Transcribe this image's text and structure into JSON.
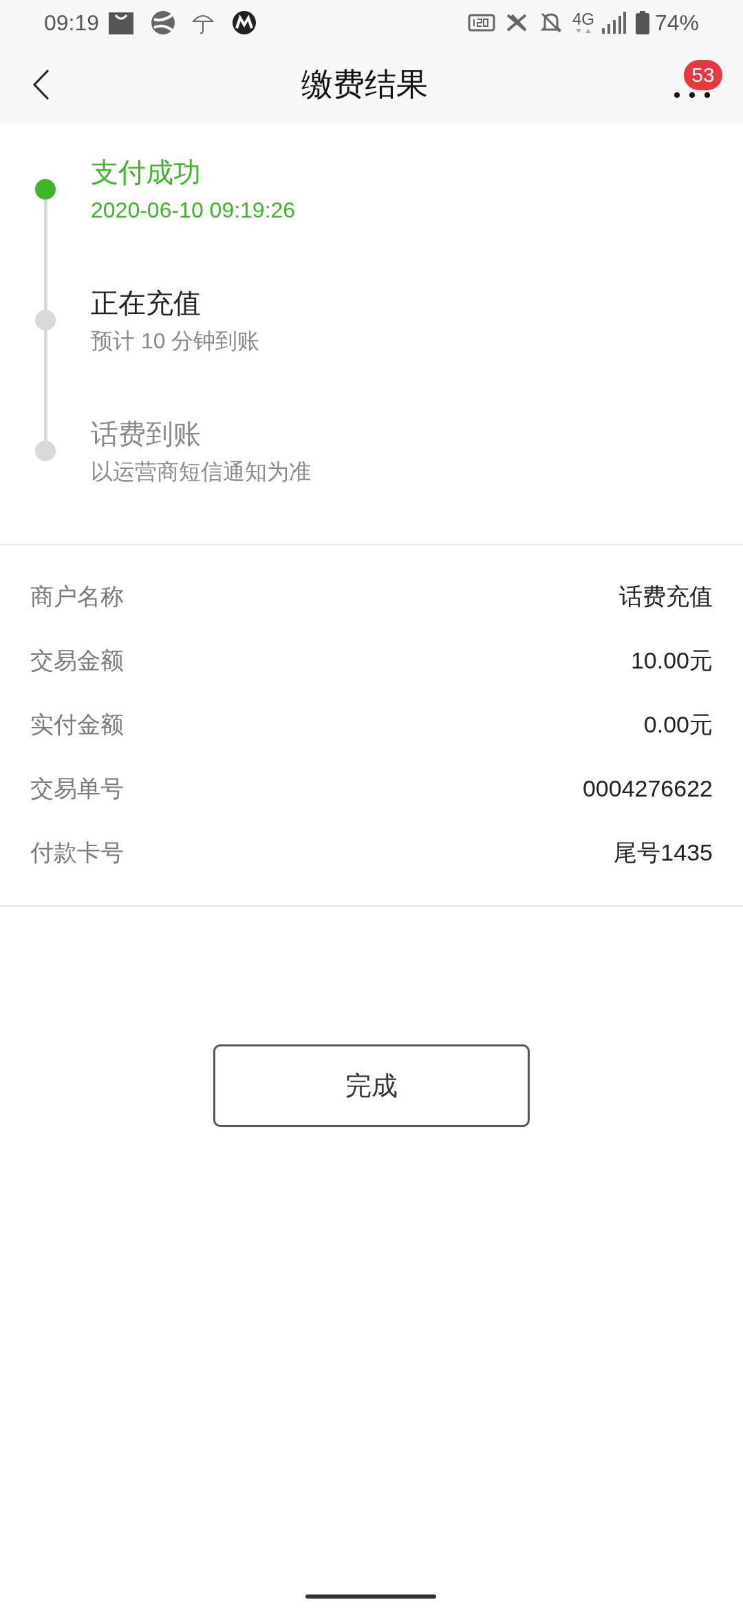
{
  "status_bar": {
    "time": "09:19",
    "network": "4G",
    "battery": "74%"
  },
  "header": {
    "title": "缴费结果",
    "badge": "53"
  },
  "steps": [
    {
      "title": "支付成功",
      "subtitle": "2020-06-10 09:19:26",
      "kind": "done"
    },
    {
      "title": "正在充值",
      "subtitle": "预计 10 分钟到账",
      "kind": "active"
    },
    {
      "title": "话费到账",
      "subtitle": "以运营商短信通知为准",
      "kind": "pending"
    }
  ],
  "details": [
    {
      "label": "商户名称",
      "value": "话费充值"
    },
    {
      "label": "交易金额",
      "value": "10.00元"
    },
    {
      "label": "实付金额",
      "value": "0.00元"
    },
    {
      "label": "交易单号",
      "value": "0004276622"
    },
    {
      "label": "付款卡号",
      "value": "尾号1435"
    }
  ],
  "button": "完成"
}
